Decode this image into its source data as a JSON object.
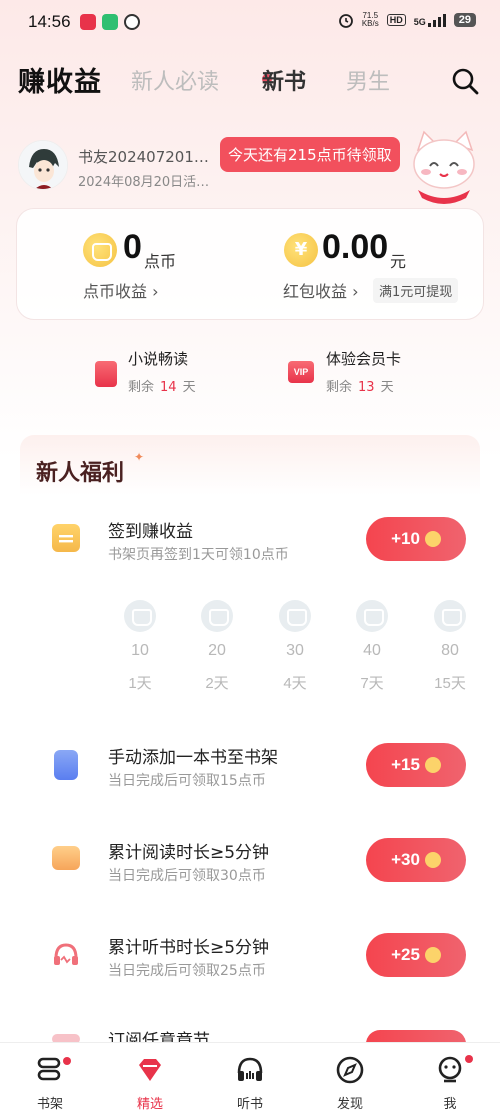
{
  "status": {
    "time": "14:56",
    "net_speed_value": "71.5",
    "net_speed_unit": "KB/s",
    "hd": "HD",
    "signal": "5G",
    "battery": "29"
  },
  "topnav": {
    "tabs": [
      {
        "label": "赚收益",
        "active": true
      },
      {
        "label": "新人必读"
      },
      {
        "label": "新书"
      },
      {
        "label": "男生"
      }
    ]
  },
  "user": {
    "name": "书友202407201…",
    "date": "2024年08月20日活…",
    "claim_tip": "今天还有215点币待领取"
  },
  "earnings": {
    "coins_value": "0",
    "coins_unit": "点币",
    "coins_label": "点币收益 ›",
    "cash_value": "0.00",
    "cash_unit": "元",
    "cash_label": "红包收益 ›",
    "withdraw_tip": "满1元可提现"
  },
  "perks": [
    {
      "title": "小说畅读",
      "remain_prefix": "剩余",
      "remain_days": "14",
      "remain_suffix": "天"
    },
    {
      "title": "体验会员卡",
      "remain_prefix": "剩余",
      "remain_days": "13",
      "remain_suffix": "天",
      "badge": "VIP"
    }
  ],
  "benefits": {
    "title": "新人福利",
    "signin": {
      "title": "签到赚收益",
      "sub": "书架页再签到1天可领10点币",
      "reward": "+10",
      "days": [
        {
          "amount": "10",
          "label": "1天"
        },
        {
          "amount": "20",
          "label": "2天"
        },
        {
          "amount": "30",
          "label": "4天"
        },
        {
          "amount": "40",
          "label": "7天"
        },
        {
          "amount": "80",
          "label": "15天"
        }
      ]
    },
    "tasks": [
      {
        "title": "手动添加一本书至书架",
        "sub": "当日完成后可领取15点币",
        "reward": "+15"
      },
      {
        "title": "累计阅读时长≥5分钟",
        "sub": "当日完成后可领取30点币",
        "reward": "+30"
      },
      {
        "title": "累计听书时长≥5分钟",
        "sub": "当日完成后可领取25点币",
        "reward": "+25"
      },
      {
        "title": "订阅任意章节",
        "sub": "",
        "reward": ""
      }
    ]
  },
  "bottom_nav": [
    {
      "label": "书架"
    },
    {
      "label": "精选",
      "active": true
    },
    {
      "label": "听书"
    },
    {
      "label": "发现"
    },
    {
      "label": "我"
    }
  ],
  "colors": {
    "accent": "#e8334a",
    "reward_button": "#f4454f",
    "coin": "#f5c243"
  }
}
